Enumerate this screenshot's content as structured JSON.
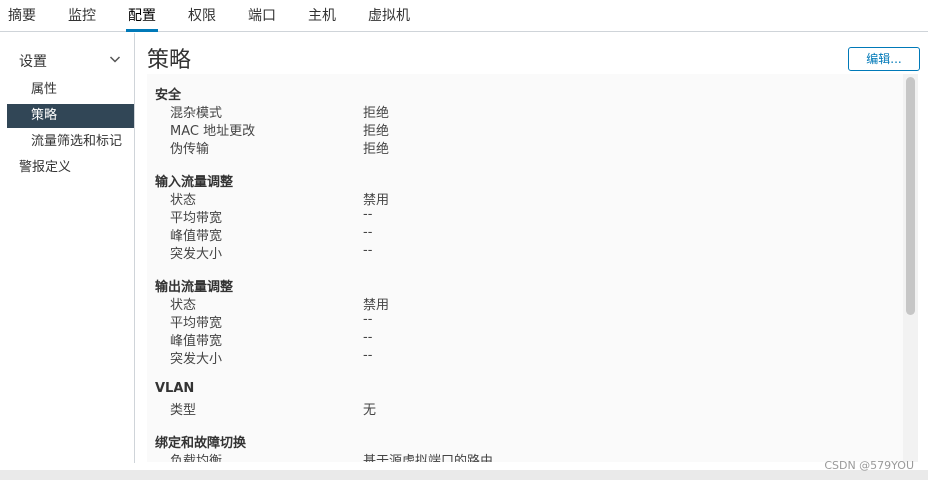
{
  "tabs": [
    {
      "label": "摘要"
    },
    {
      "label": "监控"
    },
    {
      "label": "配置"
    },
    {
      "label": "权限"
    },
    {
      "label": "端口"
    },
    {
      "label": "主机"
    },
    {
      "label": "虚拟机"
    }
  ],
  "active_tab": "配置",
  "sidebar": {
    "group_title": "设置",
    "group_icon": "chevron-down-icon",
    "items": [
      {
        "label": "属性"
      },
      {
        "label": "策略"
      },
      {
        "label": "流量筛选和标记"
      }
    ],
    "selected_item": "策略",
    "top_item": {
      "label": "警报定义"
    }
  },
  "main": {
    "title": "策略",
    "edit_label": "编辑...",
    "sections": [
      {
        "title": "安全",
        "rows": [
          {
            "label": "混杂模式",
            "value": "拒绝"
          },
          {
            "label": "MAC 地址更改",
            "value": "拒绝"
          },
          {
            "label": "伪传输",
            "value": "拒绝"
          }
        ]
      },
      {
        "title": "输入流量调整",
        "rows": [
          {
            "label": "状态",
            "value": "禁用"
          },
          {
            "label": "平均带宽",
            "value": "--"
          },
          {
            "label": "峰值带宽",
            "value": "--"
          },
          {
            "label": "突发大小",
            "value": "--"
          }
        ]
      },
      {
        "title": "输出流量调整",
        "rows": [
          {
            "label": "状态",
            "value": "禁用"
          },
          {
            "label": "平均带宽",
            "value": "--"
          },
          {
            "label": "峰值带宽",
            "value": "--"
          },
          {
            "label": "突发大小",
            "value": "--"
          }
        ]
      },
      {
        "title": "VLAN",
        "rows": [
          {
            "label": "类型",
            "value": "无"
          }
        ]
      },
      {
        "title": "绑定和故障切换",
        "rows": [
          {
            "label": "负载均衡",
            "value": "基于源虚拟端口的路由"
          }
        ]
      }
    ]
  },
  "watermark": "CSDN @579YOU",
  "colors": {
    "accent": "#0079b8",
    "selected_bg": "#314656"
  }
}
